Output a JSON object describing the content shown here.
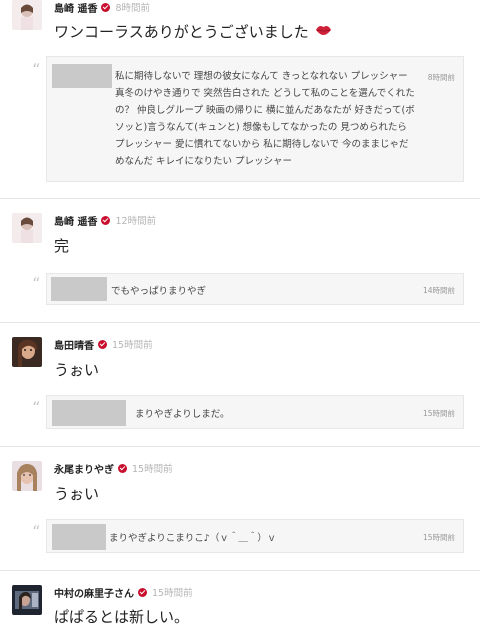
{
  "posts": [
    {
      "author": "島崎 遥香",
      "time": "8時間前",
      "body": "ワンコーラスありがとうございました",
      "emoji_icon": "lips-icon",
      "quote": {
        "text": "私に期待しないで 理想の彼女になんて きっとなれない プレッシャー 真冬のけやき通りで 突然告白された どうして私のことを選んでくれたの？ 仲良しグループ 映画の帰りに 横に並んだあなたが 好きだって(ボソッと)言うなんて(キュンと) 想像もしてなかったの 見つめられたらプレッシャー 愛に慣れてないから 私に期待しないで 今のままじゃだめなんだ キレイになりたい プレッシャー",
        "time": "8時間前"
      }
    },
    {
      "author": "島崎 遥香",
      "time": "12時間前",
      "body": "完",
      "quote": {
        "text": "でもやっぱりまりやぎ",
        "time": "14時間前"
      }
    },
    {
      "author": "島田晴香",
      "time": "15時間前",
      "body": "うぉい",
      "quote": {
        "text": "まりやぎよりしまだ。",
        "time": "15時間前"
      }
    },
    {
      "author": "永尾まりやぎ",
      "time": "15時間前",
      "body": "うぉい",
      "quote": {
        "text": "まりやぎよりこまりこ♪（ｖ＾＿＾）ｖ",
        "time": "15時間前"
      }
    },
    {
      "author": "中村の麻里子さん",
      "time": "15時間前",
      "body": "ぱぱるとは新しい。"
    }
  ],
  "colors": {
    "verified": "#c8102e",
    "timestamp": "#b4b4b4",
    "quote_bg": "#f6f6f6",
    "divider": "#e6e6e6"
  }
}
